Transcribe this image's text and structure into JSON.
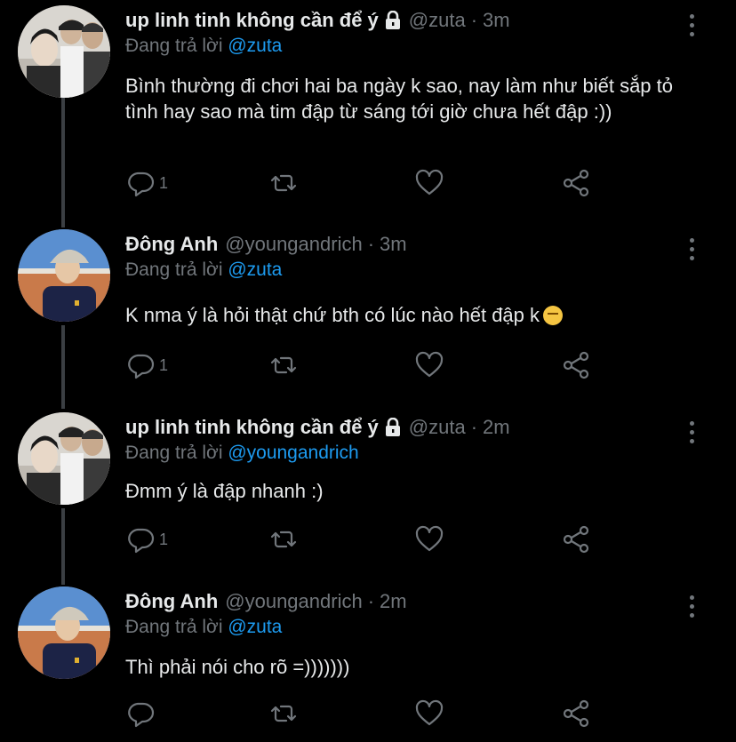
{
  "tweets": [
    {
      "name": "up linh tinh không cần để ý",
      "locked": true,
      "handle": "@zuta",
      "dot": "·",
      "time": "3m",
      "replying_prefix": "Đang trả lời",
      "replying_to": "@zuta",
      "text": "Bình thường đi chơi hai ba ngày k sao, nay làm như biết sắp tỏ tình hay sao mà tim đập từ sáng tới giờ chưa hết đập :))",
      "reply_count": "1",
      "avatar": "zuta-avatar"
    },
    {
      "name": "Đông Anh",
      "locked": false,
      "handle": "@youngandrich",
      "dot": "·",
      "time": "3m",
      "replying_prefix": "Đang trả lời",
      "replying_to": "@zuta",
      "text": "K nma ý là hỏi thật chứ bth có lúc nào hết đập k",
      "emoji": "shushing-face",
      "reply_count": "1",
      "avatar": "donganh-avatar"
    },
    {
      "name": "up linh tinh không cần để ý",
      "locked": true,
      "handle": "@zuta",
      "dot": "·",
      "time": "2m",
      "replying_prefix": "Đang trả lời",
      "replying_to": "@youngandrich",
      "text": "Đmm ý là đập nhanh :)",
      "reply_count": "1",
      "avatar": "zuta-avatar"
    },
    {
      "name": "Đông Anh",
      "locked": false,
      "handle": "@youngandrich",
      "dot": "·",
      "time": "2m",
      "replying_prefix": "Đang trả lời",
      "replying_to": "@zuta",
      "text": "Thì phải nói cho rõ =)))))))",
      "reply_count": "",
      "avatar": "donganh-avatar"
    }
  ],
  "icons": {
    "reply": "reply-icon",
    "retweet": "retweet-icon",
    "like": "like-icon",
    "share": "share-icon",
    "more": "more-icon",
    "lock": "lock-icon"
  },
  "colors": {
    "background": "#000000",
    "text": "#e7e9ea",
    "muted": "#71767b",
    "mention": "#1d9bf0",
    "thread_line": "#3b3f43"
  }
}
